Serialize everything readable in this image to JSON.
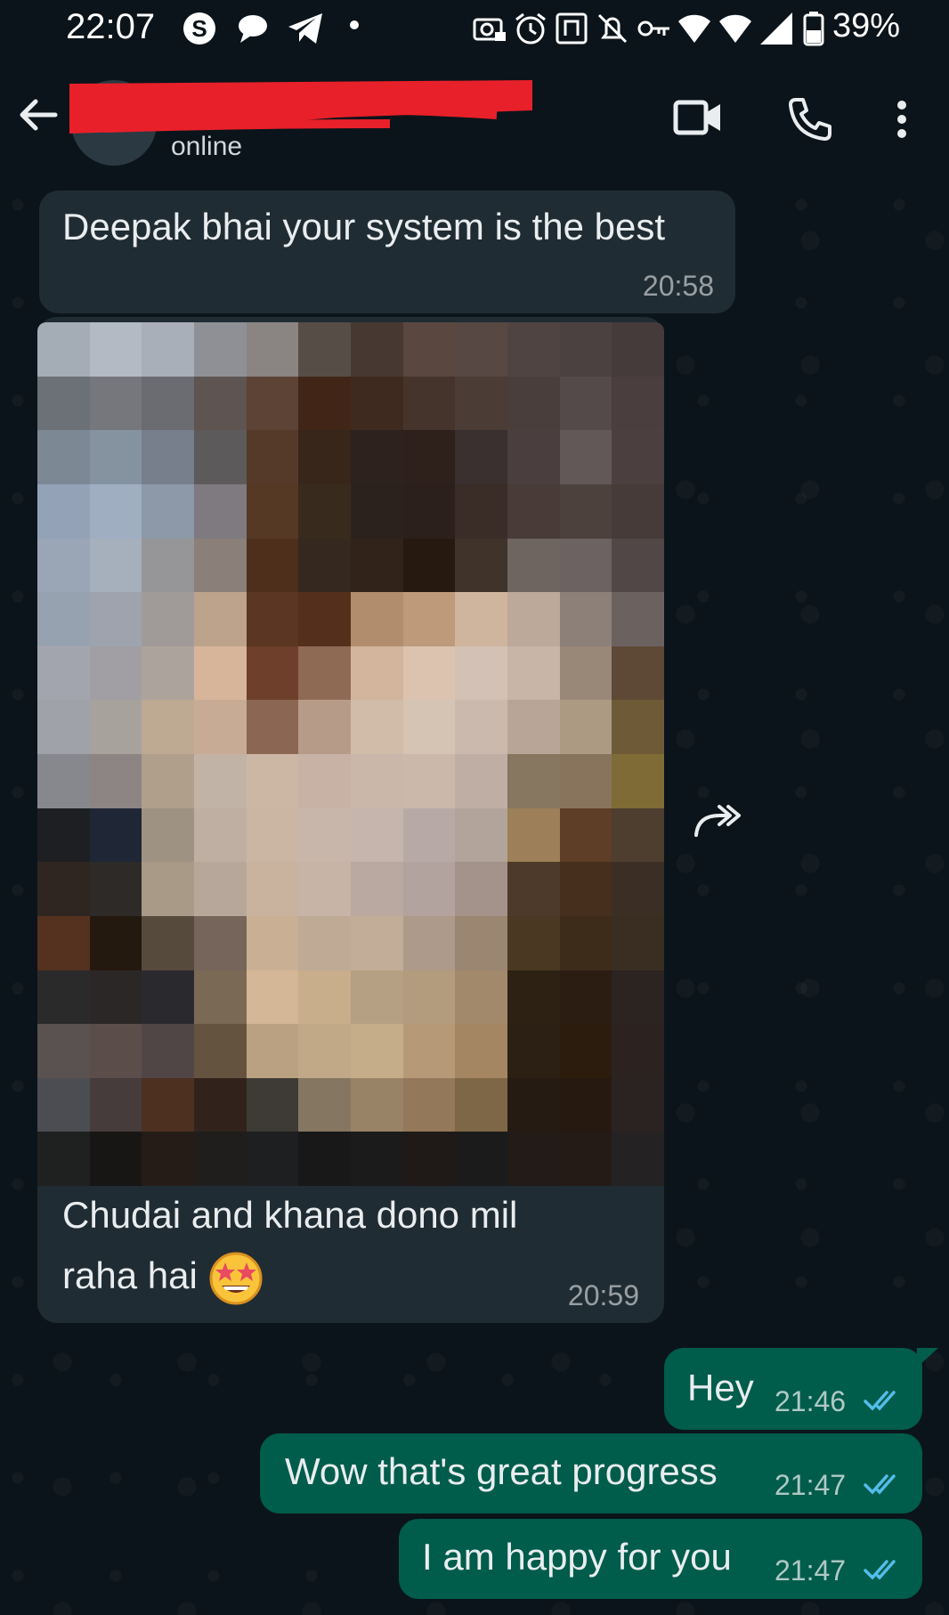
{
  "status_bar": {
    "time": "22:07",
    "battery": "39%",
    "icons": [
      "skype-icon",
      "chat-bubble-icon",
      "telegram-icon",
      "dot-icon",
      "camera-lock-icon",
      "alarm-icon",
      "nfc-icon",
      "mute-icon",
      "vpn-key-icon",
      "wifi-icon",
      "wifi-icon",
      "signal-icon",
      "battery-icon"
    ]
  },
  "header": {
    "contact_status": "online",
    "actions": [
      "video-call",
      "voice-call",
      "more-options"
    ]
  },
  "messages": [
    {
      "direction": "incoming",
      "text": "Deepak bhai your system is the best",
      "time": "20:58"
    },
    {
      "direction": "incoming",
      "type": "image",
      "caption_line1": "Chudai and khana dono mil",
      "caption_line2": "raha hai",
      "emoji": "star-struck",
      "time": "20:59"
    },
    {
      "direction": "outgoing",
      "text": "Hey",
      "time": "21:46",
      "status": "read"
    },
    {
      "direction": "outgoing",
      "text": "Wow that's great progress",
      "time": "21:47",
      "status": "read"
    },
    {
      "direction": "outgoing",
      "text": "I am happy for you",
      "time": "21:47",
      "status": "read"
    }
  ],
  "colors": {
    "background": "#0b141a",
    "incoming_bubble": "#202c33",
    "outgoing_bubble": "#005c4b",
    "read_ticks": "#53bdeb",
    "redaction": "#e8202a"
  }
}
